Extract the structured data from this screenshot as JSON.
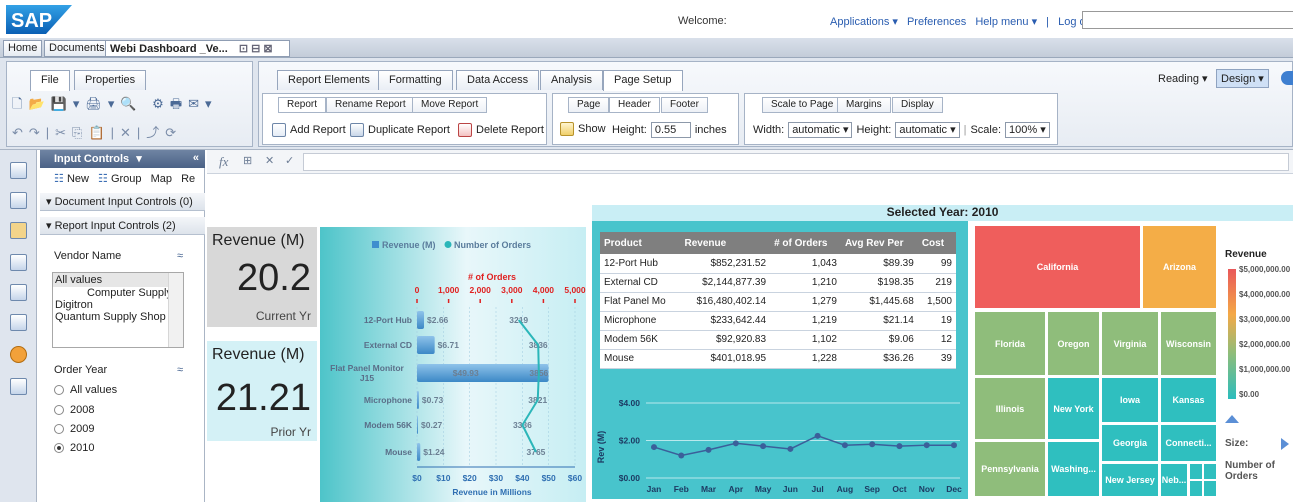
{
  "topbar": {
    "logo": "SAP",
    "welcome": "Welcome:",
    "links": [
      "Applications ▾",
      "Preferences",
      "Help menu ▾",
      "|",
      "Log off"
    ]
  },
  "doc_tabs": {
    "home": "Home",
    "documents": "Documents",
    "current": "Webi Dashboard _Ve..."
  },
  "ribbon": {
    "left_tabs": [
      "File",
      "Properties"
    ],
    "main_tabs": [
      "Report Elements",
      "Formatting",
      "Data Access",
      "Analysis",
      "Page Setup"
    ],
    "reading": "Reading",
    "design": "Design",
    "sub_report": [
      "Report",
      "Rename Report",
      "Move Report"
    ],
    "sub_page": [
      "Page",
      "Header",
      "Footer"
    ],
    "sub_scale": [
      "Scale to Page",
      "Margins",
      "Display"
    ],
    "add_report": "Add Report",
    "duplicate_report": "Duplicate Report",
    "delete_report": "Delete Report",
    "show": "Show",
    "height_label": "Height:",
    "height_value": "0.55",
    "inches": "inches",
    "width_label": "Width:",
    "width_value": "automatic",
    "height2_label": "Height:",
    "height2_value": "automatic",
    "scale_label": "Scale:",
    "scale_value": "100%"
  },
  "input_controls": {
    "title": "Input Controls",
    "new": "New",
    "group": "Group",
    "map": "Map",
    "re": "Re",
    "doc_controls": "Document Input Controls (0)",
    "report_controls": "Report Input Controls (2)",
    "vendor_label": "Vendor Name",
    "vendor_options": [
      "All values",
      "Computer Supply",
      "Digitron",
      "Quantum Supply Shop"
    ],
    "year_label": "Order Year",
    "year_options": [
      "All values",
      "2008",
      "2009",
      "2010"
    ],
    "year_selected": "2010"
  },
  "dashboard": {
    "selected_year": "Selected Year: 2010",
    "kpi1": {
      "title": "Revenue (M)",
      "value": "20.2",
      "caption": "Current Yr"
    },
    "kpi2": {
      "title": "Revenue (M)",
      "value": "21.21",
      "caption": "Prior Yr"
    },
    "table": {
      "headers": [
        "Product",
        "Revenue",
        "# of Orders",
        "Avg Rev Per",
        "Cost"
      ],
      "rows": [
        [
          "12-Port Hub",
          "$852,231.52",
          "1,043",
          "$89.39",
          "99"
        ],
        [
          "External CD",
          "$2,144,877.39",
          "1,210",
          "$198.35",
          "219"
        ],
        [
          "Flat Panel Mo",
          "$16,480,402.14",
          "1,279",
          "$1,445.68",
          "1,500"
        ],
        [
          "Microphone",
          "$233,642.44",
          "1,219",
          "$21.14",
          "19"
        ],
        [
          "Modem 56K",
          "$92,920.83",
          "1,102",
          "$9.06",
          "12"
        ],
        [
          "Mouse",
          "$401,018.95",
          "1,228",
          "$36.26",
          "39"
        ]
      ]
    },
    "treemap": {
      "title": "Revenue",
      "legend": [
        "$5,000,000.00",
        "$4,000,000.00",
        "$3,000,000.00",
        "$2,000,000.00",
        "$1,000,000.00",
        "$0.00"
      ],
      "size_label": "Size:",
      "size_value": "Number of Orders",
      "cells": [
        "California",
        "Arizona",
        "Florida",
        "Oregon",
        "Virginia",
        "Wisconsin",
        "Illinois",
        "New York",
        "Iowa",
        "Kansas",
        "Georgia",
        "Connecti...",
        "Pennsylvania",
        "Washing...",
        "New Jersey",
        "Neb..."
      ]
    }
  },
  "chart_data": [
    {
      "type": "bar",
      "legend": [
        "Revenue (M)",
        "Number of Orders"
      ],
      "categories": [
        "12-Port Hub",
        "External CD",
        "Flat Panel Monitor J15",
        "Microphone",
        "Modem 56K",
        "Mouse"
      ],
      "series": [
        {
          "name": "Revenue (M)",
          "values": [
            2.66,
            6.71,
            49.93,
            0.73,
            0.27,
            1.24
          ],
          "labels": [
            "$2.66",
            "$6.71",
            "$49.93",
            "$0.73",
            "$0.27",
            "$1.24"
          ]
        },
        {
          "name": "Number of Orders",
          "values": [
            3219,
            3836,
            3856,
            3821,
            3336,
            3765
          ]
        }
      ],
      "xlabel": "Revenue in Millions",
      "x2label": "# of Orders",
      "xticks": [
        "$0",
        "$10",
        "$20",
        "$30",
        "$40",
        "$50",
        "$60"
      ],
      "x2ticks": [
        "0",
        "1,000",
        "2,000",
        "3,000",
        "4,000",
        "5,000"
      ],
      "xlim": [
        0,
        60
      ],
      "x2lim": [
        0,
        5000
      ]
    },
    {
      "type": "line",
      "categories": [
        "Jan",
        "Feb",
        "Mar",
        "Apr",
        "May",
        "Jun",
        "Jul",
        "Aug",
        "Sep",
        "Oct",
        "Nov",
        "Dec"
      ],
      "series": [
        {
          "name": "",
          "values": [
            1.65,
            1.2,
            1.5,
            1.85,
            1.7,
            1.55,
            2.25,
            1.75,
            1.8,
            1.7,
            1.75,
            1.75
          ]
        }
      ],
      "ylabel": "Rev (M)",
      "yticks": [
        "$0.00",
        "$2.00",
        "$4.00"
      ],
      "ylim": [
        0,
        4
      ]
    }
  ]
}
